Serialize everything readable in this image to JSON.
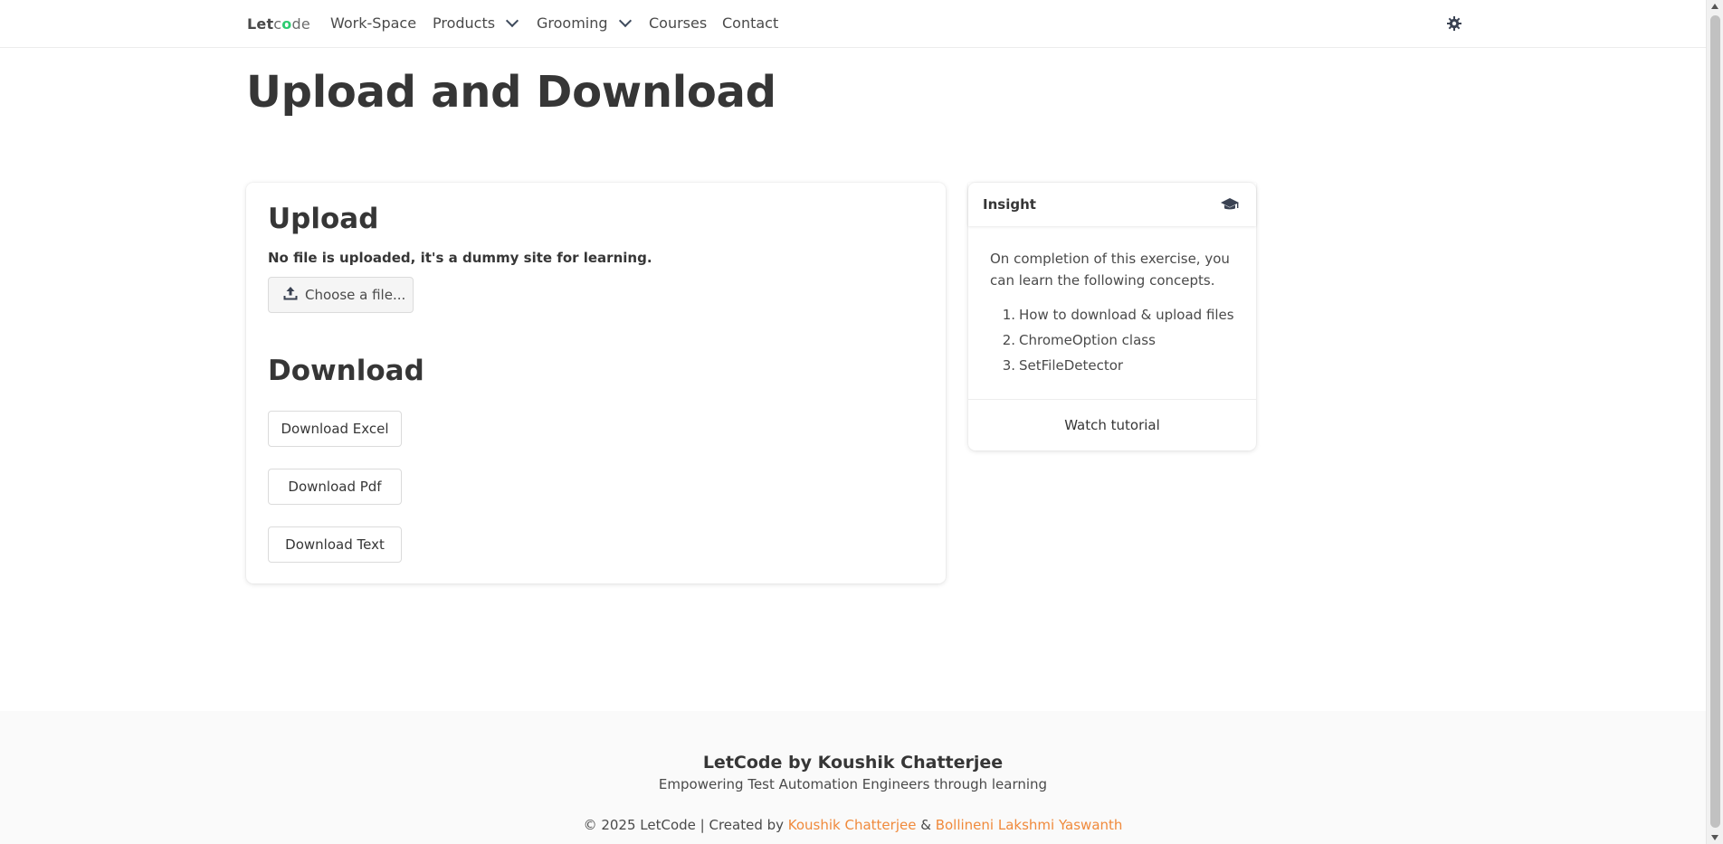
{
  "nav": {
    "brand_part1": "Let",
    "brand_part2": "c",
    "brand_dot": "o",
    "brand_part3": "de",
    "links": [
      "Work-Space",
      "Products",
      "Grooming",
      "Courses",
      "Contact"
    ],
    "theme_icon": "gear-icon"
  },
  "page": {
    "title": "Upload and Download"
  },
  "upload": {
    "heading": "Upload",
    "note": "No file is uploaded, it's a dummy site for learning.",
    "file_button": "Choose a file...",
    "file_icon": "upload-icon"
  },
  "download": {
    "heading": "Download",
    "buttons": [
      "Download Excel",
      "Download Pdf",
      "Download Text"
    ]
  },
  "insight": {
    "title": "Insight",
    "icon": "graduation-cap-icon",
    "text": "On completion of this exercise, you can learn the following concepts.",
    "items": [
      {
        "num": "1.",
        "label": "How to download & upload files"
      },
      {
        "num": "2.",
        "label": "ChromeOption class"
      },
      {
        "num": "3.",
        "label": "SetFileDetector"
      }
    ],
    "footer_link": "Watch tutorial"
  },
  "footer": {
    "title": "LetCode by Koushik Chatterjee",
    "subtitle": "Empowering Test Automation Engineers through learning",
    "copy_prefix": "© 2025 LetCode | Created by ",
    "author1": "Koushik Chatterjee",
    "amp": " & ",
    "author2": "Bollineni Lakshmi Yaswanth"
  },
  "colors": {
    "accent_link": "#f08a3c",
    "brand_dot": "#2ecc71",
    "text": "#363636"
  }
}
